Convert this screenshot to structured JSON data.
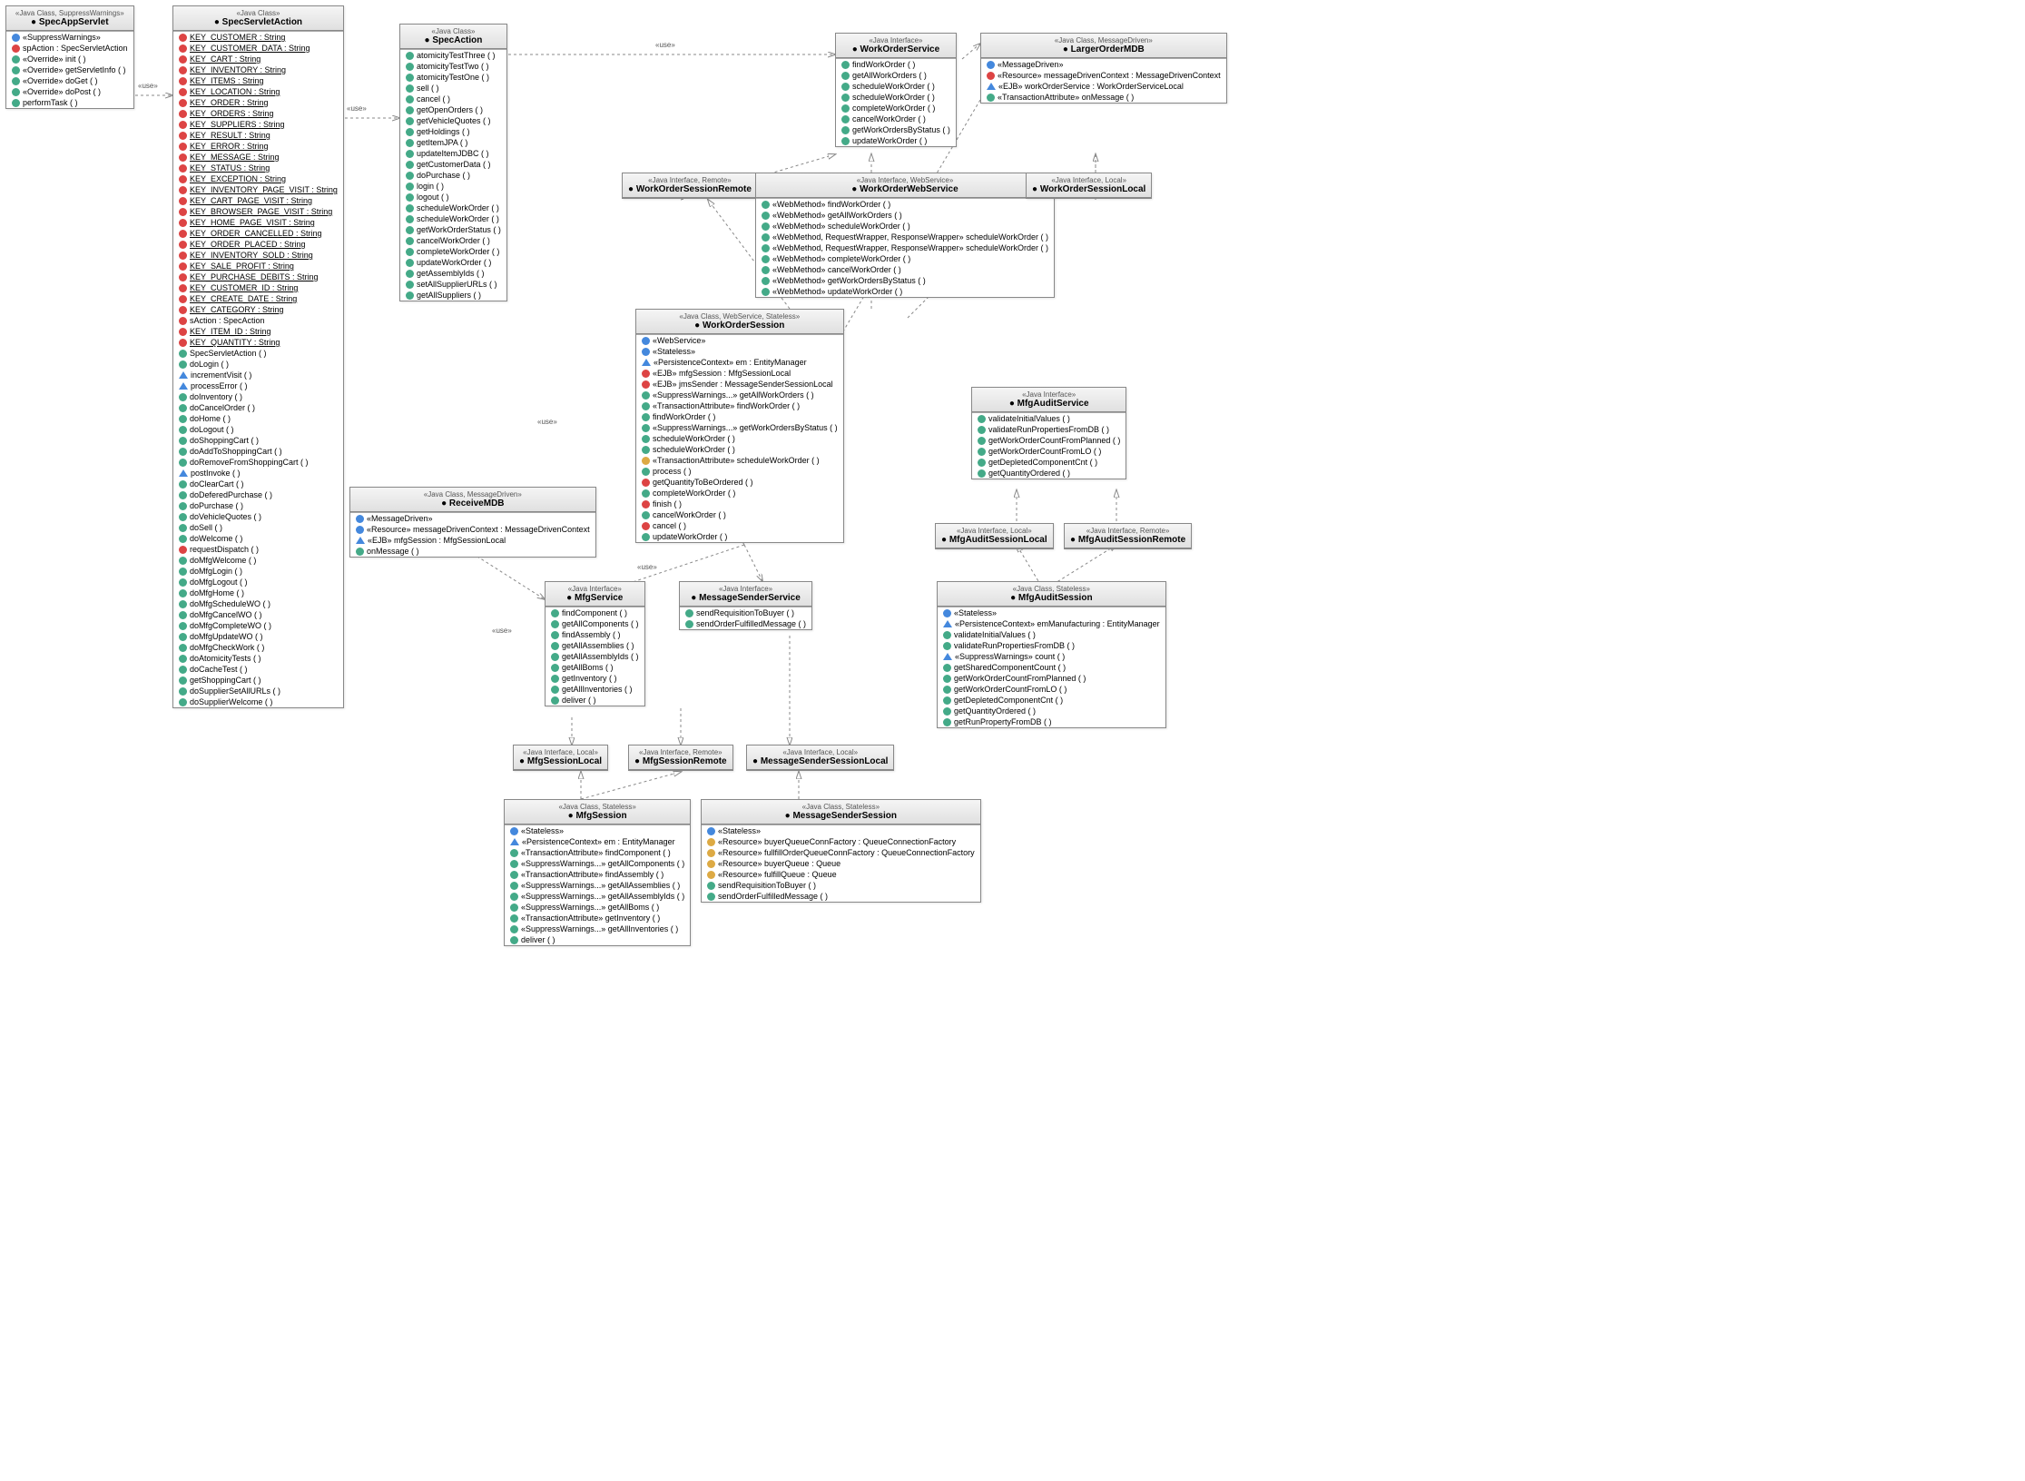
{
  "SpecAppServlet": {
    "stereo": "«Java Class, SuppressWarnings»",
    "name": "SpecAppServlet",
    "rows": [
      {
        "ic": "b",
        "t": "«SuppressWarnings»"
      },
      {
        "ic": "r",
        "t": "spAction : SpecServletAction"
      },
      {
        "ic": "g",
        "t": "«Override» init ( )"
      },
      {
        "ic": "g",
        "t": "«Override» getServletInfo ( )"
      },
      {
        "ic": "g",
        "t": "«Override» doGet ( )"
      },
      {
        "ic": "g",
        "t": "«Override» doPost ( )"
      },
      {
        "ic": "g",
        "t": "performTask ( )"
      }
    ]
  },
  "SpecServletAction": {
    "stereo": "«Java Class»",
    "name": "SpecServletAction",
    "rows": [
      {
        "ic": "r",
        "t": "KEY_CUSTOMER : String",
        "u": 1
      },
      {
        "ic": "r",
        "t": "KEY_CUSTOMER_DATA : String",
        "u": 1
      },
      {
        "ic": "r",
        "t": "KEY_CART : String",
        "u": 1
      },
      {
        "ic": "r",
        "t": "KEY_INVENTORY : String",
        "u": 1
      },
      {
        "ic": "r",
        "t": "KEY_ITEMS : String",
        "u": 1
      },
      {
        "ic": "r",
        "t": "KEY_LOCATION : String",
        "u": 1
      },
      {
        "ic": "r",
        "t": "KEY_ORDER : String",
        "u": 1
      },
      {
        "ic": "r",
        "t": "KEY_ORDERS : String",
        "u": 1
      },
      {
        "ic": "r",
        "t": "KEY_SUPPLIERS : String",
        "u": 1
      },
      {
        "ic": "r",
        "t": "KEY_RESULT : String",
        "u": 1
      },
      {
        "ic": "r",
        "t": "KEY_ERROR : String",
        "u": 1
      },
      {
        "ic": "r",
        "t": "KEY_MESSAGE : String",
        "u": 1
      },
      {
        "ic": "r",
        "t": "KEY_STATUS : String",
        "u": 1
      },
      {
        "ic": "r",
        "t": "KEY_EXCEPTION : String",
        "u": 1
      },
      {
        "ic": "r",
        "t": "KEY_INVENTORY_PAGE_VISIT : String",
        "u": 1
      },
      {
        "ic": "r",
        "t": "KEY_CART_PAGE_VISIT : String",
        "u": 1
      },
      {
        "ic": "r",
        "t": "KEY_BROWSER_PAGE_VISIT : String",
        "u": 1
      },
      {
        "ic": "r",
        "t": "KEY_HOME_PAGE_VISIT : String",
        "u": 1
      },
      {
        "ic": "r",
        "t": "KEY_ORDER_CANCELLED : String",
        "u": 1
      },
      {
        "ic": "r",
        "t": "KEY_ORDER_PLACED : String",
        "u": 1
      },
      {
        "ic": "r",
        "t": "KEY_INVENTORY_SOLD : String",
        "u": 1
      },
      {
        "ic": "r",
        "t": "KEY_SALE_PROFIT : String",
        "u": 1
      },
      {
        "ic": "r",
        "t": "KEY_PURCHASE_DEBITS : String",
        "u": 1
      },
      {
        "ic": "r",
        "t": "KEY_CUSTOMER_ID : String",
        "u": 1
      },
      {
        "ic": "r",
        "t": "KEY_CREATE_DATE : String",
        "u": 1
      },
      {
        "ic": "r",
        "t": "KEY_CATEGORY : String",
        "u": 1
      },
      {
        "ic": "r",
        "t": "sAction : SpecAction"
      },
      {
        "ic": "r",
        "t": "KEY_ITEM_ID : String",
        "u": 1
      },
      {
        "ic": "r",
        "t": "KEY_QUANTITY : String",
        "u": 1
      },
      {
        "ic": "g",
        "t": "SpecServletAction ( )"
      },
      {
        "ic": "g",
        "t": "doLogin ( )"
      },
      {
        "ic": "t",
        "t": "incrementVisit ( )"
      },
      {
        "ic": "t",
        "t": "processError ( )"
      },
      {
        "ic": "g",
        "t": "doInventory ( )"
      },
      {
        "ic": "g",
        "t": "doCancelOrder ( )"
      },
      {
        "ic": "g",
        "t": "doHome ( )"
      },
      {
        "ic": "g",
        "t": "doLogout ( )"
      },
      {
        "ic": "g",
        "t": "doShoppingCart ( )"
      },
      {
        "ic": "g",
        "t": "doAddToShoppingCart ( )"
      },
      {
        "ic": "g",
        "t": "doRemoveFromShoppingCart ( )"
      },
      {
        "ic": "t",
        "t": "postInvoke ( )"
      },
      {
        "ic": "g",
        "t": "doClearCart ( )"
      },
      {
        "ic": "g",
        "t": "doDeferedPurchase ( )"
      },
      {
        "ic": "g",
        "t": "doPurchase ( )"
      },
      {
        "ic": "g",
        "t": "doVehicleQuotes ( )"
      },
      {
        "ic": "g",
        "t": "doSell ( )"
      },
      {
        "ic": "g",
        "t": "doWelcome ( )"
      },
      {
        "ic": "r",
        "t": "requestDispatch ( )"
      },
      {
        "ic": "g",
        "t": "doMfgWelcome ( )"
      },
      {
        "ic": "g",
        "t": "doMfgLogin ( )"
      },
      {
        "ic": "g",
        "t": "doMfgLogout ( )"
      },
      {
        "ic": "g",
        "t": "doMfgHome ( )"
      },
      {
        "ic": "g",
        "t": "doMfgScheduleWO ( )"
      },
      {
        "ic": "g",
        "t": "doMfgCancelWO ( )"
      },
      {
        "ic": "g",
        "t": "doMfgCompleteWO ( )"
      },
      {
        "ic": "g",
        "t": "doMfgUpdateWO ( )"
      },
      {
        "ic": "g",
        "t": "doMfgCheckWork ( )"
      },
      {
        "ic": "g",
        "t": "doAtomicityTests ( )"
      },
      {
        "ic": "g",
        "t": "doCacheTest ( )"
      },
      {
        "ic": "g",
        "t": "getShoppingCart ( )"
      },
      {
        "ic": "g",
        "t": "doSupplierSetAllURLs ( )"
      },
      {
        "ic": "g",
        "t": "doSupplierWelcome ( )"
      }
    ]
  },
  "SpecAction": {
    "stereo": "«Java Class»",
    "name": "SpecAction",
    "rows": [
      {
        "ic": "g",
        "t": "atomicityTestThree ( )"
      },
      {
        "ic": "g",
        "t": "atomicityTestTwo ( )"
      },
      {
        "ic": "g",
        "t": "atomicityTestOne ( )"
      },
      {
        "ic": "g",
        "t": "sell ( )"
      },
      {
        "ic": "g",
        "t": "cancel ( )"
      },
      {
        "ic": "g",
        "t": "getOpenOrders ( )"
      },
      {
        "ic": "g",
        "t": "getVehicleQuotes ( )"
      },
      {
        "ic": "g",
        "t": "getHoldings ( )"
      },
      {
        "ic": "g",
        "t": "getItemJPA ( )"
      },
      {
        "ic": "g",
        "t": "updateItemJDBC ( )"
      },
      {
        "ic": "g",
        "t": "getCustomerData ( )"
      },
      {
        "ic": "g",
        "t": "doPurchase ( )"
      },
      {
        "ic": "g",
        "t": "login ( )"
      },
      {
        "ic": "g",
        "t": "logout ( )"
      },
      {
        "ic": "g",
        "t": "scheduleWorkOrder ( )"
      },
      {
        "ic": "g",
        "t": "scheduleWorkOrder ( )"
      },
      {
        "ic": "g",
        "t": "getWorkOrderStatus ( )"
      },
      {
        "ic": "g",
        "t": "cancelWorkOrder ( )"
      },
      {
        "ic": "g",
        "t": "completeWorkOrder ( )"
      },
      {
        "ic": "g",
        "t": "updateWorkOrder ( )"
      },
      {
        "ic": "g",
        "t": "getAssemblyIds ( )"
      },
      {
        "ic": "g",
        "t": "setAllSupplierURLs ( )"
      },
      {
        "ic": "g",
        "t": "getAllSuppliers ( )"
      }
    ]
  },
  "WorkOrderService": {
    "stereo": "«Java Interface»",
    "name": "WorkOrderService",
    "rows": [
      {
        "ic": "g",
        "t": "findWorkOrder ( )"
      },
      {
        "ic": "g",
        "t": "getAllWorkOrders ( )"
      },
      {
        "ic": "g",
        "t": "scheduleWorkOrder ( )"
      },
      {
        "ic": "g",
        "t": "scheduleWorkOrder ( )"
      },
      {
        "ic": "g",
        "t": "completeWorkOrder ( )"
      },
      {
        "ic": "g",
        "t": "cancelWorkOrder ( )"
      },
      {
        "ic": "g",
        "t": "getWorkOrdersByStatus ( )"
      },
      {
        "ic": "g",
        "t": "updateWorkOrder ( )"
      }
    ]
  },
  "LargerOrderMDB": {
    "stereo": "«Java Class, MessageDriven»",
    "name": "LargerOrderMDB",
    "rows": [
      {
        "ic": "b",
        "t": "«MessageDriven»"
      },
      {
        "ic": "r",
        "t": "«Resource» messageDrivenContext : MessageDrivenContext"
      },
      {
        "ic": "t",
        "t": "«EJB» workOrderService : WorkOrderServiceLocal"
      },
      {
        "ic": "g",
        "t": "«TransactionAttribute» onMessage ( )"
      }
    ]
  },
  "WorkOrderSessionRemote": {
    "stereo": "«Java Interface, Remote»",
    "name": "WorkOrderSessionRemote",
    "rows": []
  },
  "WorkOrderWebService": {
    "stereo": "«Java Interface, WebService»",
    "name": "WorkOrderWebService",
    "rows": [
      {
        "ic": "g",
        "t": "«WebMethod» findWorkOrder ( )"
      },
      {
        "ic": "g",
        "t": "«WebMethod» getAllWorkOrders ( )"
      },
      {
        "ic": "g",
        "t": "«WebMethod» scheduleWorkOrder ( )"
      },
      {
        "ic": "g",
        "t": "«WebMethod, RequestWrapper, ResponseWrapper» scheduleWorkOrder ( )"
      },
      {
        "ic": "g",
        "t": "«WebMethod, RequestWrapper, ResponseWrapper» scheduleWorkOrder ( )"
      },
      {
        "ic": "g",
        "t": "«WebMethod» completeWorkOrder ( )"
      },
      {
        "ic": "g",
        "t": "«WebMethod» cancelWorkOrder ( )"
      },
      {
        "ic": "g",
        "t": "«WebMethod» getWorkOrdersByStatus ( )"
      },
      {
        "ic": "g",
        "t": "«WebMethod» updateWorkOrder ( )"
      }
    ]
  },
  "WorkOrderSessionLocal": {
    "stereo": "«Java Interface, Local»",
    "name": "WorkOrderSessionLocal",
    "rows": []
  },
  "WorkOrderSession": {
    "stereo": "«Java Class, WebService, Stateless»",
    "name": "WorkOrderSession",
    "rows": [
      {
        "ic": "b",
        "t": "«WebService»"
      },
      {
        "ic": "b",
        "t": "«Stateless»"
      },
      {
        "ic": "t",
        "t": "«PersistenceContext» em : EntityManager"
      },
      {
        "ic": "r",
        "t": "«EJB» mfgSession : MfgSessionLocal"
      },
      {
        "ic": "r",
        "t": "«EJB» jmsSender : MessageSenderSessionLocal"
      },
      {
        "ic": "g",
        "t": "«SuppressWarnings...» getAllWorkOrders ( )"
      },
      {
        "ic": "g",
        "t": "«TransactionAttribute» findWorkOrder ( )"
      },
      {
        "ic": "g",
        "t": "findWorkOrder ( )"
      },
      {
        "ic": "g",
        "t": "«SuppressWarnings...» getWorkOrdersByStatus ( )"
      },
      {
        "ic": "g",
        "t": "scheduleWorkOrder ( )"
      },
      {
        "ic": "g",
        "t": "scheduleWorkOrder ( )"
      },
      {
        "ic": "y",
        "t": "«TransactionAttribute» scheduleWorkOrder ( )"
      },
      {
        "ic": "g",
        "t": "process ( )"
      },
      {
        "ic": "r",
        "t": "getQuantityToBeOrdered ( )"
      },
      {
        "ic": "g",
        "t": "completeWorkOrder ( )"
      },
      {
        "ic": "r",
        "t": "finish ( )"
      },
      {
        "ic": "g",
        "t": "cancelWorkOrder ( )"
      },
      {
        "ic": "r",
        "t": "cancel ( )"
      },
      {
        "ic": "g",
        "t": "updateWorkOrder ( )"
      }
    ]
  },
  "MfgAuditService": {
    "stereo": "«Java Interface»",
    "name": "MfgAuditService",
    "rows": [
      {
        "ic": "g",
        "t": "validateInitialValues ( )"
      },
      {
        "ic": "g",
        "t": "validateRunPropertiesFromDB ( )"
      },
      {
        "ic": "g",
        "t": "getWorkOrderCountFromPlanned ( )"
      },
      {
        "ic": "g",
        "t": "getWorkOrderCountFromLO ( )"
      },
      {
        "ic": "g",
        "t": "getDepletedComponentCnt ( )"
      },
      {
        "ic": "g",
        "t": "getQuantityOrdered ( )"
      }
    ]
  },
  "ReceiveMDB": {
    "stereo": "«Java Class, MessageDriven»",
    "name": "ReceiveMDB",
    "rows": [
      {
        "ic": "b",
        "t": "«MessageDriven»"
      },
      {
        "ic": "b",
        "t": "«Resource» messageDrivenContext : MessageDrivenContext"
      },
      {
        "ic": "t",
        "t": "«EJB» mfgSession : MfgSessionLocal"
      },
      {
        "ic": "g",
        "t": "onMessage ( )"
      }
    ]
  },
  "MfgAuditSessionLocal": {
    "stereo": "«Java Interface, Local»",
    "name": "MfgAuditSessionLocal",
    "rows": []
  },
  "MfgAuditSessionRemote": {
    "stereo": "«Java Interface, Remote»",
    "name": "MfgAuditSessionRemote",
    "rows": []
  },
  "MfgService": {
    "stereo": "«Java Interface»",
    "name": "MfgService",
    "rows": [
      {
        "ic": "g",
        "t": "findComponent ( )"
      },
      {
        "ic": "g",
        "t": "getAllComponents ( )"
      },
      {
        "ic": "g",
        "t": "findAssembly ( )"
      },
      {
        "ic": "g",
        "t": "getAllAssemblies ( )"
      },
      {
        "ic": "g",
        "t": "getAllAssemblyIds ( )"
      },
      {
        "ic": "g",
        "t": "getAllBoms ( )"
      },
      {
        "ic": "g",
        "t": "getInventory ( )"
      },
      {
        "ic": "g",
        "t": "getAllInventories ( )"
      },
      {
        "ic": "g",
        "t": "deliver ( )"
      }
    ]
  },
  "MessageSenderService": {
    "stereo": "«Java Interface»",
    "name": "MessageSenderService",
    "rows": [
      {
        "ic": "g",
        "t": "sendRequisitionToBuyer ( )"
      },
      {
        "ic": "g",
        "t": "sendOrderFulfilledMessage ( )"
      }
    ]
  },
  "MfgAuditSession": {
    "stereo": "«Java Class, Stateless»",
    "name": "MfgAuditSession",
    "rows": [
      {
        "ic": "b",
        "t": "«Stateless»"
      },
      {
        "ic": "t",
        "t": "«PersistenceContext» emManufacturing : EntityManager"
      },
      {
        "ic": "g",
        "t": "validateInitialValues ( )"
      },
      {
        "ic": "g",
        "t": "validateRunPropertiesFromDB ( )"
      },
      {
        "ic": "t",
        "t": "«SuppressWarnings» count ( )"
      },
      {
        "ic": "g",
        "t": "getSharedComponentCount ( )"
      },
      {
        "ic": "g",
        "t": "getWorkOrderCountFromPlanned ( )"
      },
      {
        "ic": "g",
        "t": "getWorkOrderCountFromLO ( )"
      },
      {
        "ic": "g",
        "t": "getDepletedComponentCnt ( )"
      },
      {
        "ic": "g",
        "t": "getQuantityOrdered ( )"
      },
      {
        "ic": "g",
        "t": "getRunPropertyFromDB ( )"
      }
    ]
  },
  "MfgSessionLocal": {
    "stereo": "«Java Interface, Local»",
    "name": "MfgSessionLocal",
    "rows": []
  },
  "MfgSessionRemote": {
    "stereo": "«Java Interface, Remote»",
    "name": "MfgSessionRemote",
    "rows": []
  },
  "MessageSenderSessionLocal": {
    "stereo": "«Java Interface, Local»",
    "name": "MessageSenderSessionLocal",
    "rows": []
  },
  "MfgSession": {
    "stereo": "«Java Class, Stateless»",
    "name": "MfgSession",
    "rows": [
      {
        "ic": "b",
        "t": "«Stateless»"
      },
      {
        "ic": "t",
        "t": "«PersistenceContext» em : EntityManager"
      },
      {
        "ic": "g",
        "t": "«TransactionAttribute» findComponent ( )"
      },
      {
        "ic": "g",
        "t": "«SuppressWarnings...» getAllComponents ( )"
      },
      {
        "ic": "g",
        "t": "«TransactionAttribute» findAssembly ( )"
      },
      {
        "ic": "g",
        "t": "«SuppressWarnings...» getAllAssemblies ( )"
      },
      {
        "ic": "g",
        "t": "«SuppressWarnings...» getAllAssemblyIds ( )"
      },
      {
        "ic": "g",
        "t": "«SuppressWarnings...» getAllBoms ( )"
      },
      {
        "ic": "g",
        "t": "«TransactionAttribute» getInventory ( )"
      },
      {
        "ic": "g",
        "t": "«SuppressWarnings...» getAllInventories ( )"
      },
      {
        "ic": "g",
        "t": "deliver ( )"
      }
    ]
  },
  "MessageSenderSession": {
    "stereo": "«Java Class, Stateless»",
    "name": "MessageSenderSession",
    "rows": [
      {
        "ic": "b",
        "t": "«Stateless»"
      },
      {
        "ic": "y",
        "t": "«Resource» buyerQueueConnFactory : QueueConnectionFactory"
      },
      {
        "ic": "y",
        "t": "«Resource» fullfillOrderQueueConnFactory : QueueConnectionFactory"
      },
      {
        "ic": "y",
        "t": "«Resource» buyerQueue : Queue"
      },
      {
        "ic": "y",
        "t": "«Resource» fulfillQueue : Queue"
      },
      {
        "ic": "g",
        "t": "sendRequisitionToBuyer ( )"
      },
      {
        "ic": "g",
        "t": "sendOrderFulfilledMessage ( )"
      }
    ]
  },
  "labels": {
    "use": "«use»"
  }
}
